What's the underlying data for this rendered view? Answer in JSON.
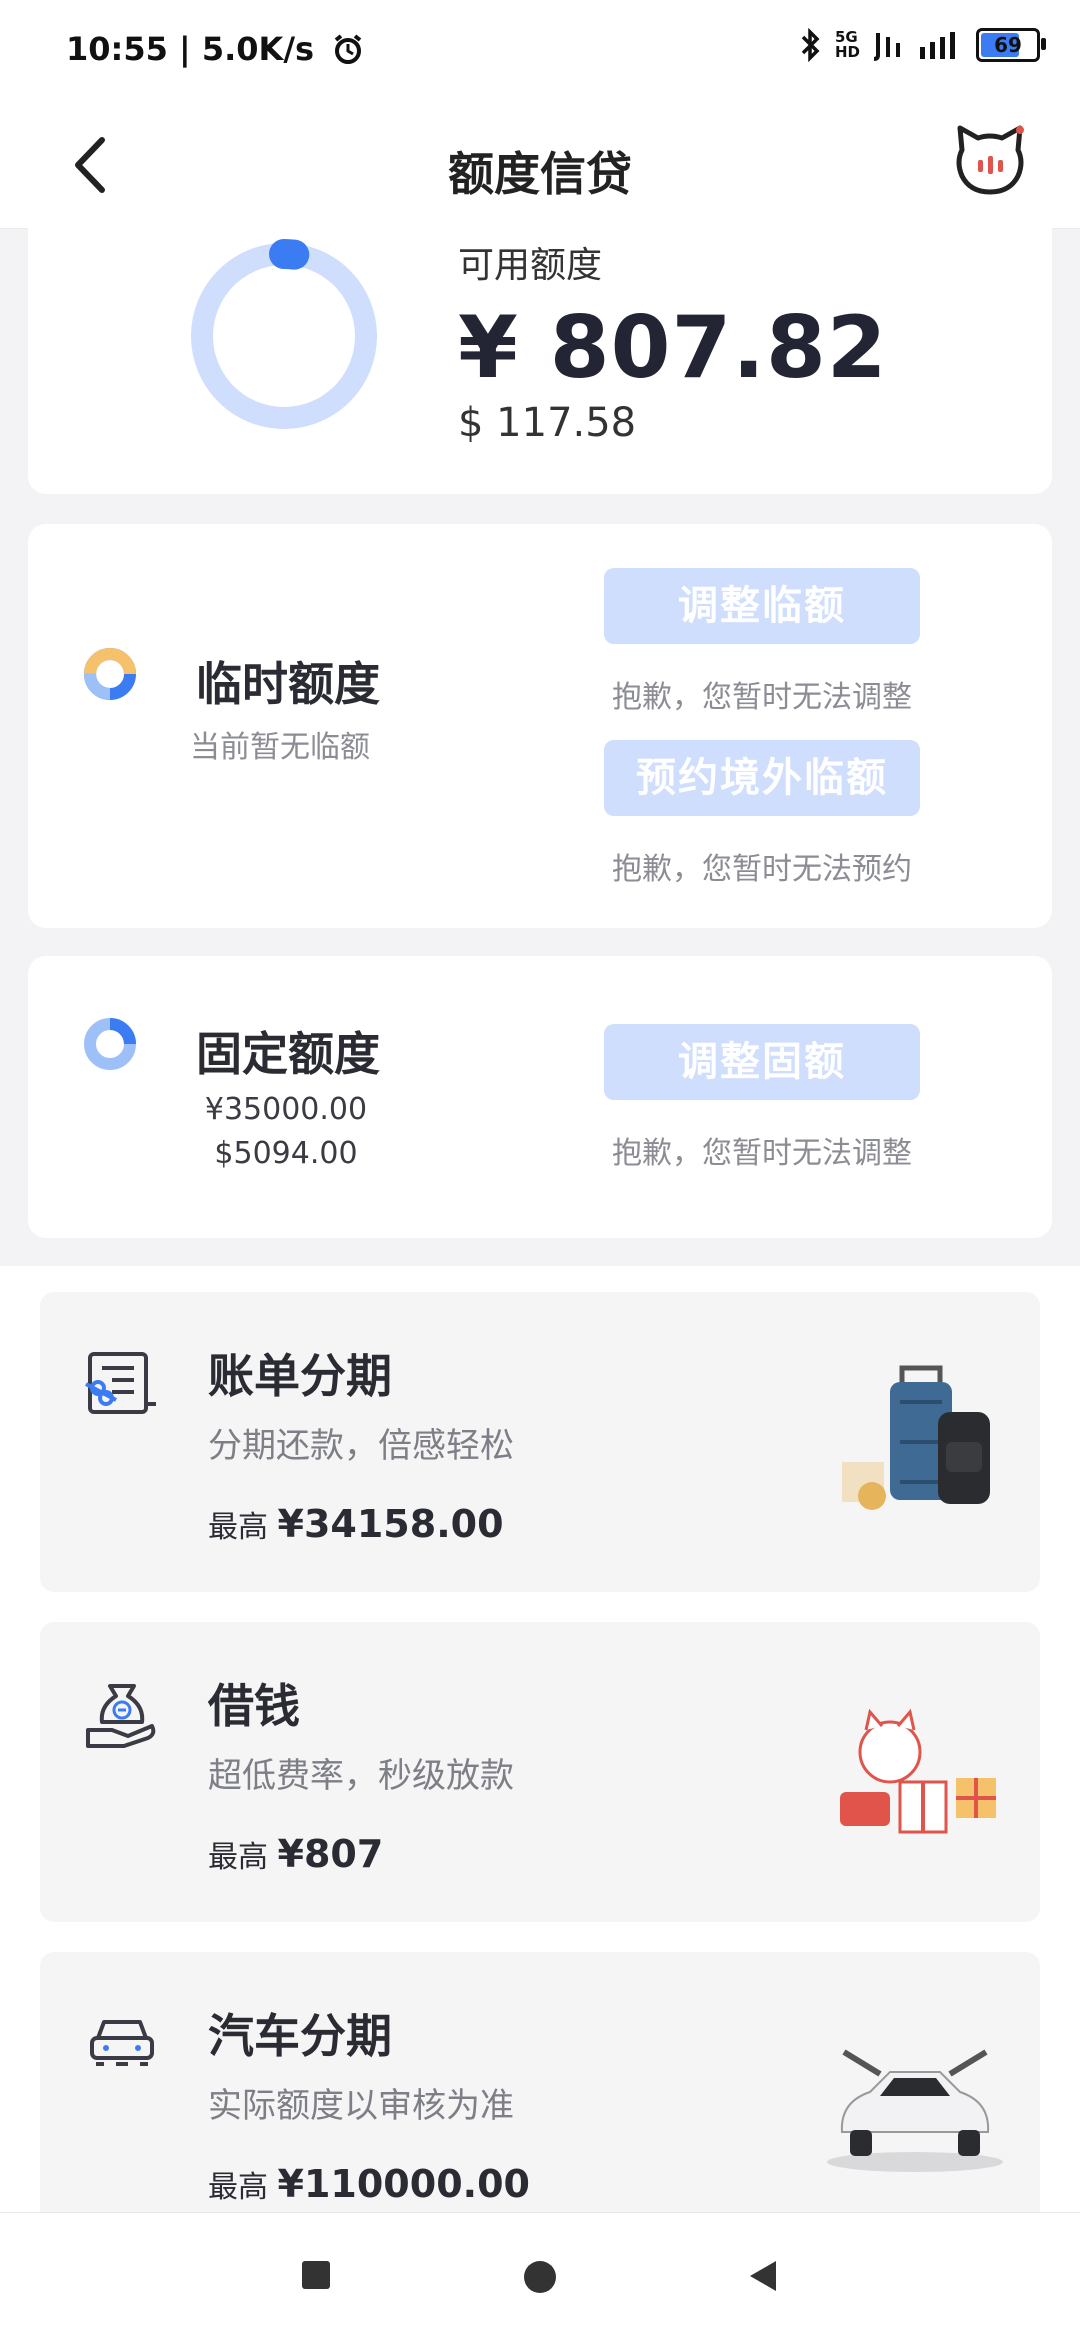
{
  "status_bar": {
    "time_speed": "10:55 | 5.0K/s",
    "network_top": "5G",
    "network_bottom": "HD",
    "battery": "69"
  },
  "header": {
    "title": "额度信贷"
  },
  "available": {
    "label": "可用额度",
    "cny": "¥ 807.82",
    "usd": "$ 117.58",
    "used_fraction": 0.02
  },
  "temp_quota": {
    "title": "临时额度",
    "subtitle": "当前暂无临额",
    "adjust_button": "调整临额",
    "adjust_note": "抱歉，您暂时无法调整",
    "reserve_button": "预约境外临额",
    "reserve_note": "抱歉，您暂时无法预约"
  },
  "fixed_quota": {
    "title": "固定额度",
    "cny": "¥35000.00",
    "usd": "$5094.00",
    "adjust_button": "调整固额",
    "adjust_note": "抱歉，您暂时无法调整"
  },
  "products": [
    {
      "title": "账单分期",
      "subtitle": "分期还款，倍感轻松",
      "max_label": "最高",
      "max_value": "¥34158.00",
      "icon": "bill-installment-icon"
    },
    {
      "title": "借钱",
      "subtitle": "超低费率，秒级放款",
      "max_label": "最高",
      "max_value": "¥807",
      "icon": "money-bag-hand-icon"
    },
    {
      "title": "汽车分期",
      "subtitle": "实际额度以审核为准",
      "max_label": "最高",
      "max_value": "¥110000.00",
      "icon": "car-icon"
    }
  ],
  "colors": {
    "accent": "#3b7cf3",
    "accent_light": "#cfdefc",
    "disabled_button": "#cfdefc",
    "temp_icon_orange": "#f5c26b"
  }
}
